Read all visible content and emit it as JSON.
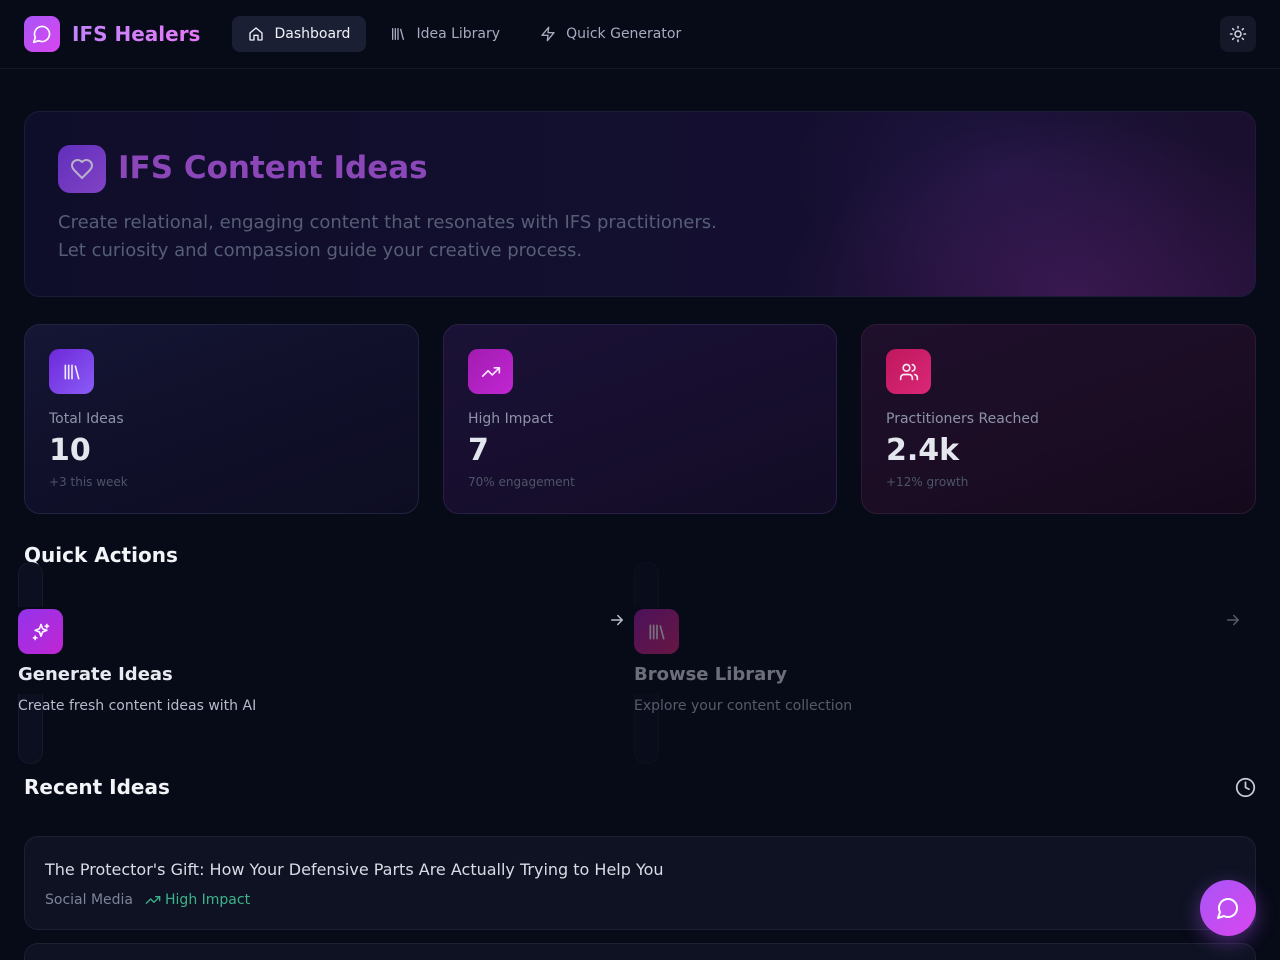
{
  "app": {
    "name": "IFS Healers",
    "logo_icon": "message-circle-icon"
  },
  "nav": {
    "tabs": [
      {
        "label": "Dashboard",
        "icon": "home-icon",
        "active": true
      },
      {
        "label": "Idea Library",
        "icon": "library-icon",
        "active": false
      },
      {
        "label": "Quick Generator",
        "icon": "zap-icon",
        "active": false
      }
    ],
    "theme_toggle_icon": "sun-icon"
  },
  "hero": {
    "title": "IFS Content Ideas",
    "icon": "heart-icon",
    "line1": "Create relational, engaging content that resonates with IFS practitioners.",
    "line2": "Let curiosity and compassion guide your creative process."
  },
  "stats": [
    {
      "label": "Total Ideas",
      "value": "10",
      "sub": "+3 this week",
      "icon": "library-icon"
    },
    {
      "label": "High Impact",
      "value": "7",
      "sub": "70% engagement",
      "icon": "trending-up-icon"
    },
    {
      "label": "Practitioners Reached",
      "value": "2.4k",
      "sub": "+12% growth",
      "icon": "users-icon"
    }
  ],
  "quick_actions": {
    "title": "Quick Actions",
    "items": [
      {
        "title": "Generate Ideas",
        "desc": "Create fresh content ideas with AI",
        "icon": "sparkles-icon"
      },
      {
        "title": "Browse Library",
        "desc": "Explore your content collection",
        "icon": "library-icon"
      }
    ]
  },
  "recent": {
    "title": "Recent Ideas",
    "icon": "clock-icon",
    "items": [
      {
        "title": "The Protector's Gift: How Your Defensive Parts Are Actually Trying to Help You",
        "category": "Social Media",
        "impact": "High Impact"
      }
    ]
  },
  "colors": {
    "background": "#070a17",
    "accent": "#a855f7",
    "accent_pink": "#d946ef",
    "impact_green": "#3bb38a"
  }
}
